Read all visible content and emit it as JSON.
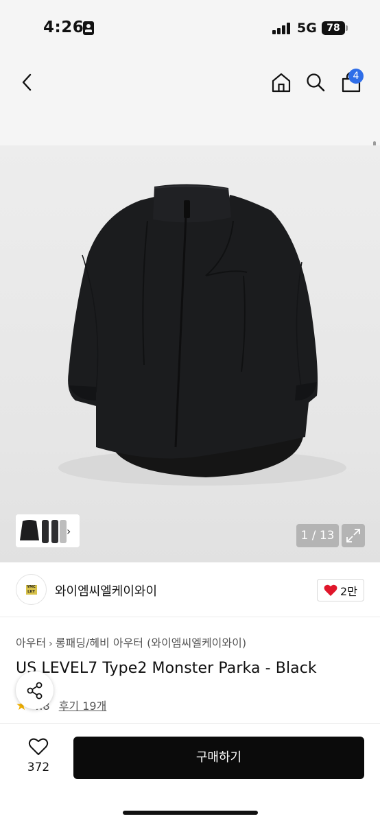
{
  "status_bar": {
    "time": "4:26",
    "network": "5G",
    "battery": "78"
  },
  "header": {
    "cart_count": "4",
    "icons": [
      "back-chevron-icon",
      "home-icon",
      "search-icon",
      "shopping-bag-icon"
    ]
  },
  "gallery": {
    "counter": "1 / 13",
    "thumbnail_more": "›"
  },
  "shop": {
    "name": "와이엠씨엘케이와이",
    "logo_text": "YMC LKY",
    "likes": "2만",
    "brand_color": "#d8c24a"
  },
  "product": {
    "breadcrumb": [
      "아우터",
      "롱패딩/헤비 아우터 (와이엠씨엘케이와이)"
    ],
    "title": "US LEVEL7 Type2 Monster Parka - Black",
    "rating": "4.8",
    "reviews": "후기 19개"
  },
  "bottom_bar": {
    "wishlist_count": "372",
    "buy_label": "구매하기"
  },
  "colors": {
    "accent": "#2f6ee8",
    "like_heart": "#e0162b",
    "rating_star": "#f5b301",
    "buy_button": "#0b0b0b"
  }
}
